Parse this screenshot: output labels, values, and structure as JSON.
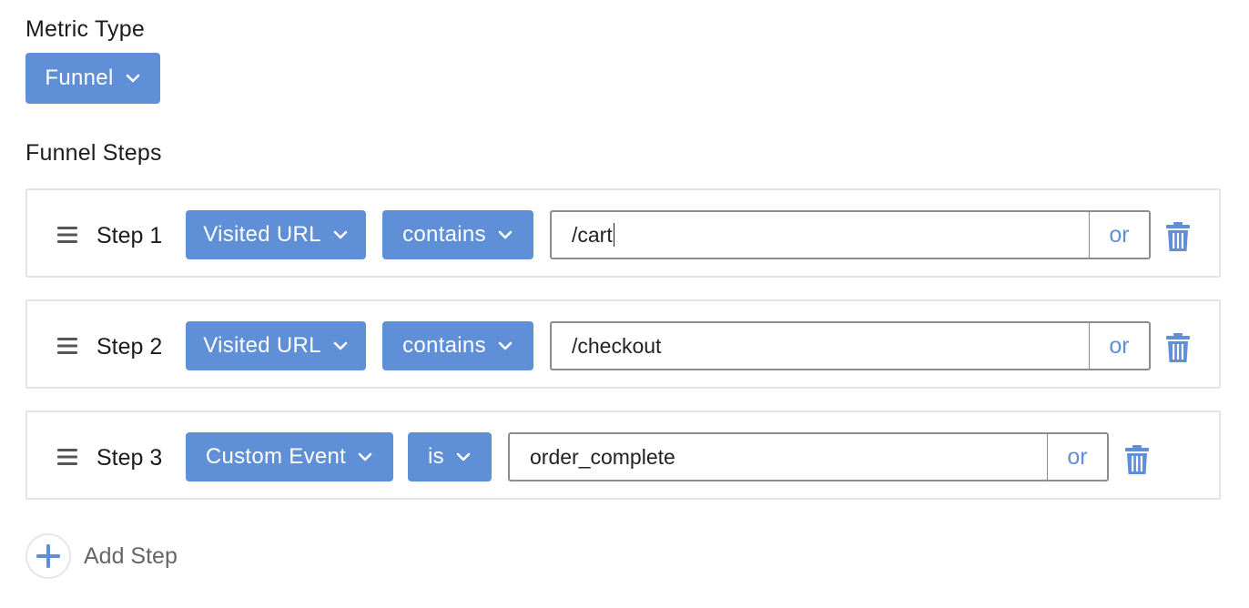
{
  "metric_type": {
    "label": "Metric Type",
    "selected": "Funnel"
  },
  "funnel_steps": {
    "label": "Funnel Steps",
    "steps": [
      {
        "label": "Step 1",
        "source": "Visited URL",
        "operator": "contains",
        "value": "/cart",
        "or_label": "or"
      },
      {
        "label": "Step 2",
        "source": "Visited URL",
        "operator": "contains",
        "value": "/checkout",
        "or_label": "or"
      },
      {
        "label": "Step 3",
        "source": "Custom Event",
        "operator": "is",
        "value": "order_complete",
        "or_label": "or"
      }
    ]
  },
  "add_step": {
    "label": "Add Step"
  },
  "colors": {
    "accent": "#5f8fd6",
    "border": "#e4e4e4",
    "input_border": "#8c8c8c"
  },
  "icons": {
    "drag": "drag-handle-icon",
    "chevron": "chevron-down-icon",
    "trash": "trash-icon",
    "add": "plus-icon"
  }
}
